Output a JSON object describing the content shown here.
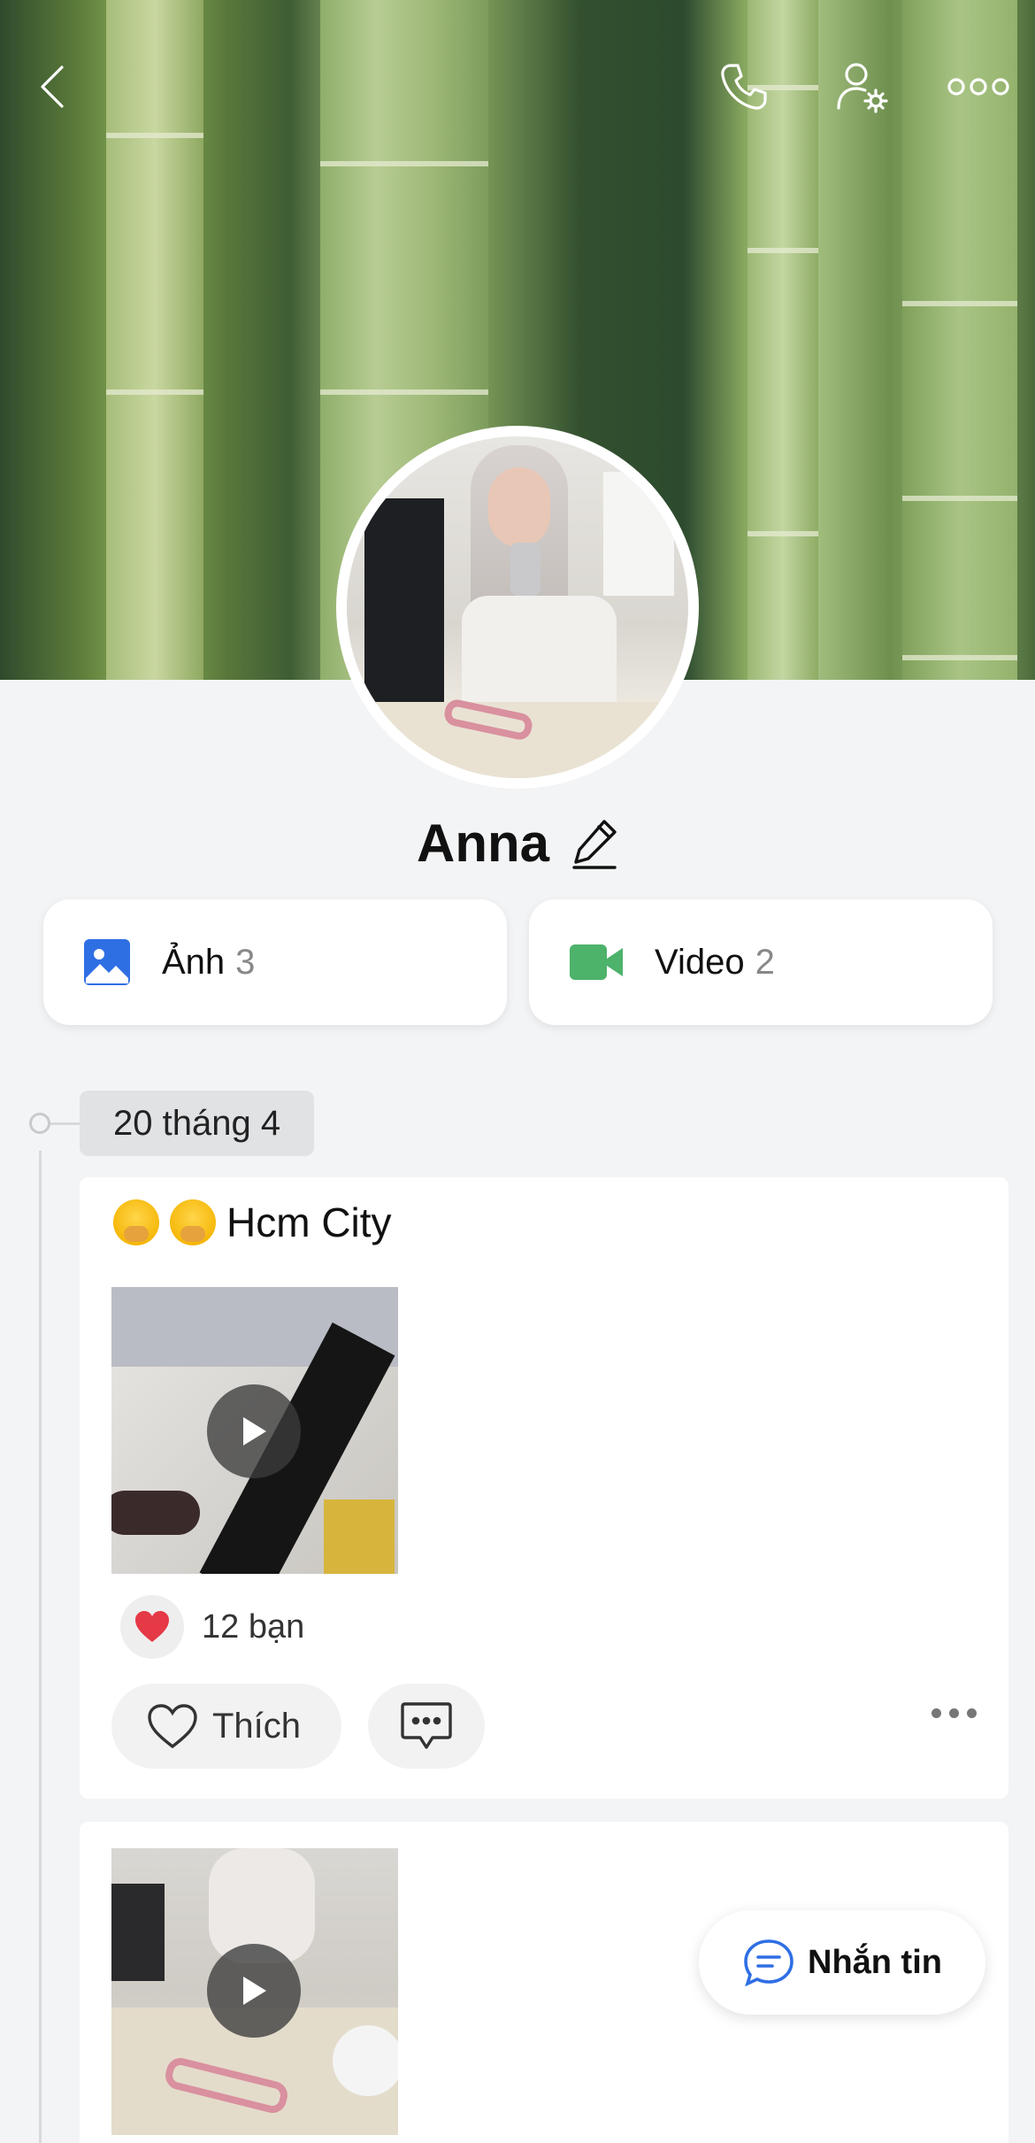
{
  "profile": {
    "name": "Anna",
    "media": [
      {
        "label": "Ảnh",
        "count": "3",
        "icon": "image-icon",
        "color": "#2f6fe4"
      },
      {
        "label": "Video",
        "count": "2",
        "icon": "video-icon",
        "color": "#4db26a"
      }
    ]
  },
  "timeline": {
    "date": "20 tháng 4",
    "posts": [
      {
        "caption": "Hcm City",
        "emojis": [
          "hand-over-mouth-emoji",
          "hand-over-mouth-emoji"
        ],
        "reactions": "12 bạn",
        "like_label": "Thích"
      }
    ]
  },
  "fab": {
    "label": "Nhắn tin",
    "icon": "chat-bubble-icon"
  },
  "colors": {
    "accent": "#2f6fe4",
    "heart": "#e53946",
    "background": "#f3f4f6"
  }
}
